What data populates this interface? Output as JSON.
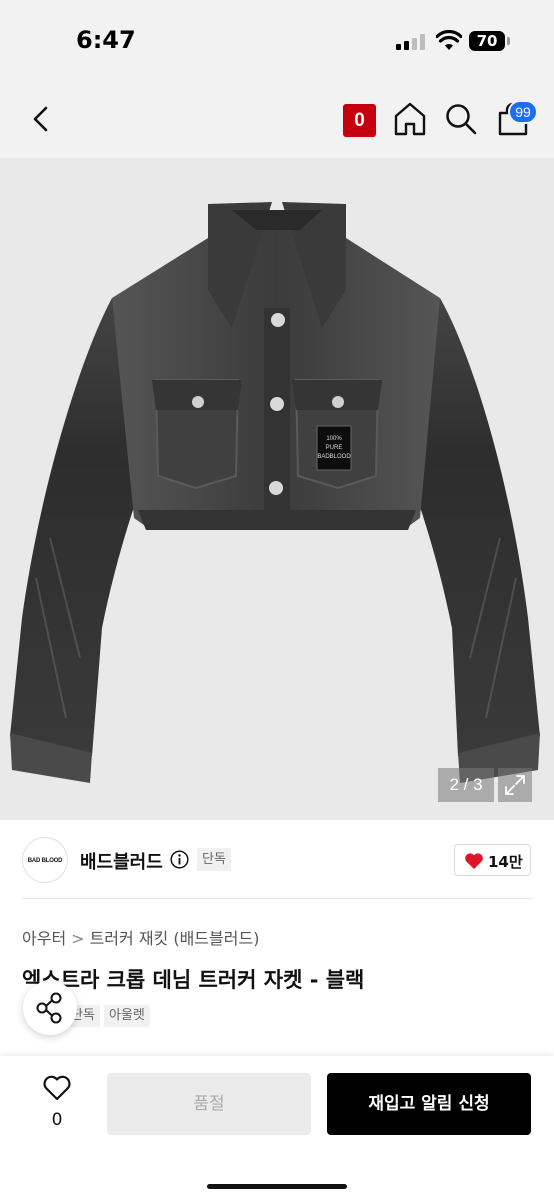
{
  "status_bar": {
    "time": "6:47",
    "battery": "70"
  },
  "nav": {
    "brand_badge": "0",
    "cart_count": "99",
    "icons": [
      "chevron-left-icon",
      "home-icon",
      "search-icon",
      "shopping-bag-icon"
    ]
  },
  "gallery": {
    "counter": "2 / 3",
    "image_label_lines": [
      "100%",
      "PURE",
      "BADBLOOD"
    ]
  },
  "brand": {
    "logo_text": "BAD BLOOD",
    "name": "배드블러드",
    "tag": "단독",
    "like_count": "14만"
  },
  "breadcrumb": {
    "items": [
      "아우터",
      "트러커 재킷 (배드블러드)"
    ],
    "separator": ">"
  },
  "product": {
    "title": "엑스트라 크롭 데님 트러커 자켓 - 블랙",
    "tags": [
      "단독",
      "아울렛"
    ]
  },
  "bottom_bar": {
    "wish_count": "0",
    "soldout_label": "품절",
    "restock_label": "재입고 알림 신청"
  },
  "colors": {
    "brand_badge": "#c4000f",
    "cart_badge": "#1c6ef2",
    "heart": "#e0142b",
    "primary_button": "#000000",
    "disabled_button": "#ebebeb"
  }
}
